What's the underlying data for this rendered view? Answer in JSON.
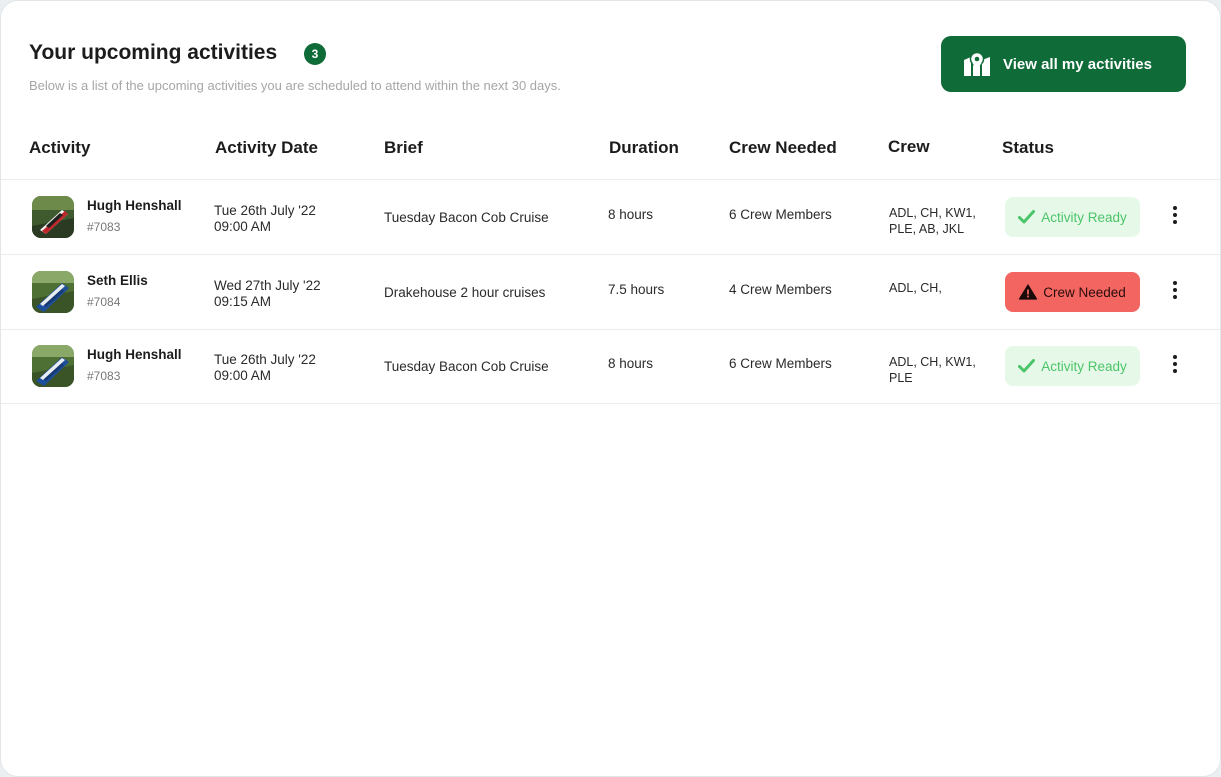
{
  "header": {
    "title": "Your upcoming activities",
    "count": "3",
    "subtitle": "Below is a list of the upcoming activities you are scheduled to attend within the next 30 days.",
    "view_all_label": "View all my activities"
  },
  "table": {
    "columns": [
      "Activity",
      "Activity Date",
      "Brief",
      "Duration",
      "Crew Needed",
      "Crew",
      "Status"
    ],
    "rows": [
      {
        "name": "Hugh Henshall",
        "ref": "#7083",
        "date_line1": "Tue 26th July '22",
        "date_line2": "09:00 AM",
        "brief": "Tuesday Bacon Cob Cruise",
        "duration": "8 hours",
        "crew_needed": "6 Crew Members",
        "crew_line1": "ADL, CH, KW1,",
        "crew_line2": "PLE, AB, JKL",
        "status": "Activity Ready",
        "status_type": "ready"
      },
      {
        "name": "Seth Ellis",
        "ref": "#7084",
        "date_line1": "Wed 27th July '22",
        "date_line2": "09:15 AM",
        "brief": "Drakehouse 2 hour cruises",
        "duration": "7.5 hours",
        "crew_needed": "4 Crew Members",
        "crew_line1": "ADL, CH,",
        "crew_line2": "",
        "status": "Crew Needed",
        "status_type": "needed"
      },
      {
        "name": "Hugh Henshall",
        "ref": "#7083",
        "date_line1": "Tue 26th July '22",
        "date_line2": "09:00 AM",
        "brief": "Tuesday Bacon Cob Cruise",
        "duration": "8 hours",
        "crew_needed": "6 Crew Members",
        "crew_line1": "ADL, CH, KW1,",
        "crew_line2": "PLE",
        "status": "Activity Ready",
        "status_type": "ready"
      }
    ]
  },
  "icons": {
    "view_all": "map-pin-icon",
    "ready": "check-icon",
    "needed": "warning-icon",
    "row_menu": "more-vertical-icon"
  },
  "colors": {
    "brand_green": "#0f6b37",
    "ready_bg": "#e6f9e8",
    "ready_text": "#4cc46a",
    "needed_bg": "#f26561"
  }
}
